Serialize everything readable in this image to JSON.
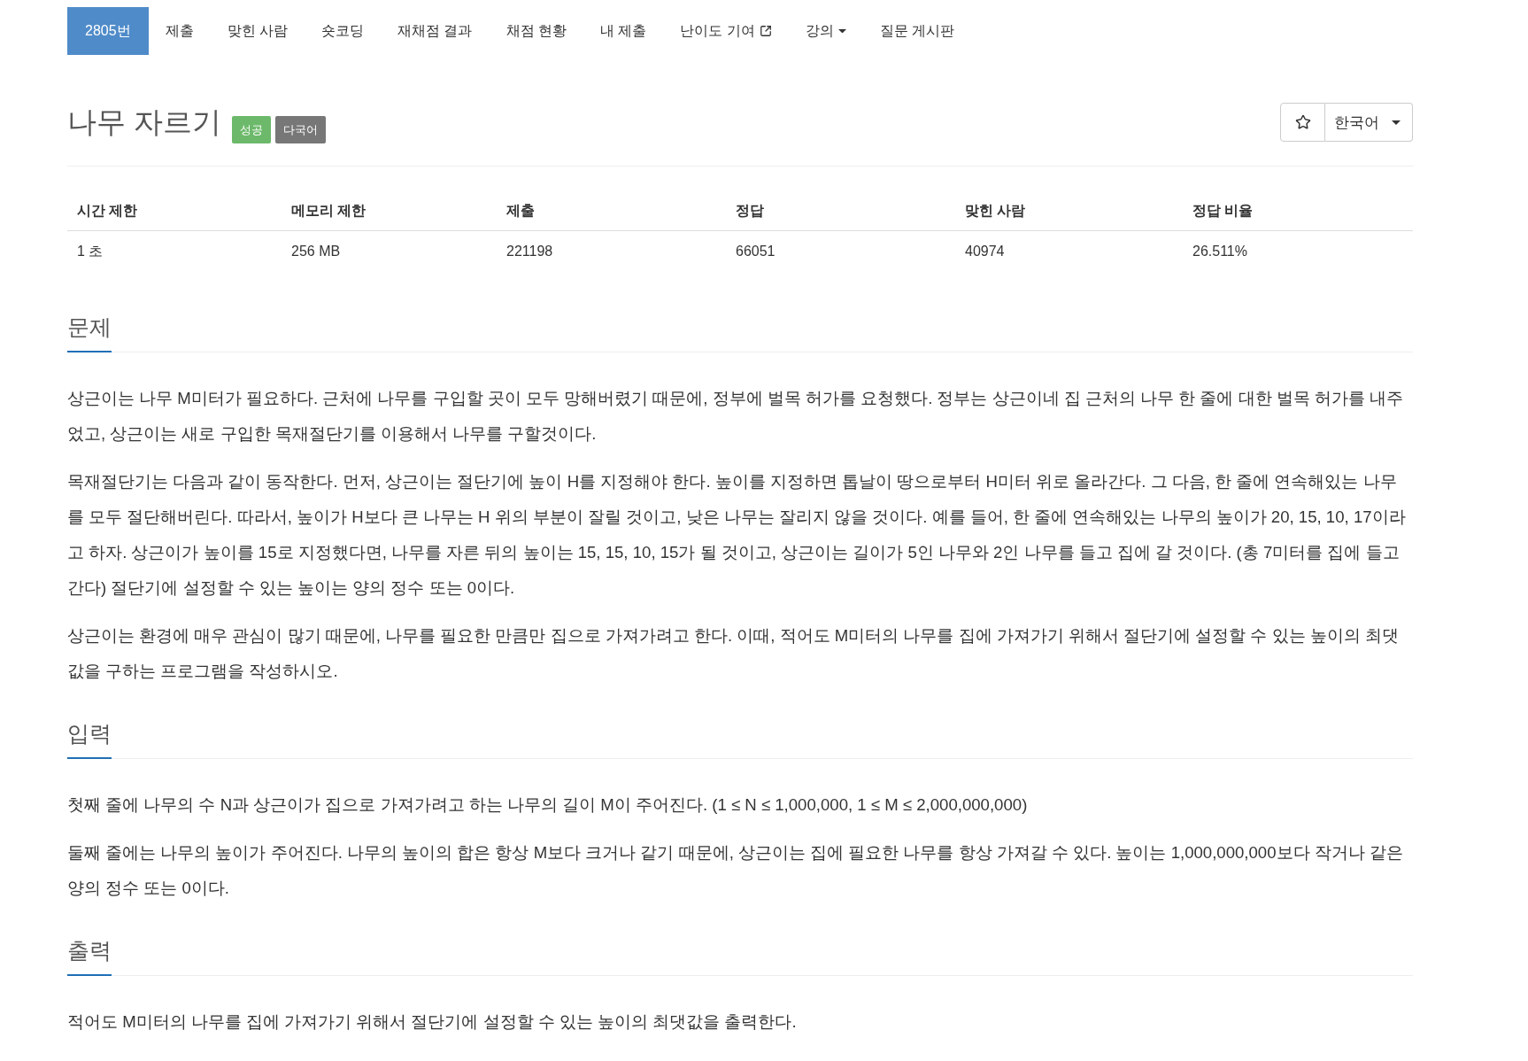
{
  "nav": {
    "items": [
      {
        "label": "2805번",
        "selected": true,
        "kind": "plain"
      },
      {
        "label": "제출",
        "selected": false,
        "kind": "plain"
      },
      {
        "label": "맞힌 사람",
        "selected": false,
        "kind": "plain"
      },
      {
        "label": "숏코딩",
        "selected": false,
        "kind": "plain"
      },
      {
        "label": "재채점 결과",
        "selected": false,
        "kind": "plain"
      },
      {
        "label": "채점 현황",
        "selected": false,
        "kind": "plain"
      },
      {
        "label": "내 제출",
        "selected": false,
        "kind": "plain"
      },
      {
        "label": "난이도 기여",
        "selected": false,
        "kind": "external"
      },
      {
        "label": "강의",
        "selected": false,
        "kind": "dropdown"
      },
      {
        "label": "질문 게시판",
        "selected": false,
        "kind": "plain"
      }
    ]
  },
  "problem": {
    "title": "나무 자르기",
    "badges": [
      {
        "label": "성공",
        "color": "#6db96b"
      },
      {
        "label": "다국어",
        "color": "#777777"
      }
    ]
  },
  "language_select": {
    "value": "한국어"
  },
  "stats": {
    "columns": [
      "시간 제한",
      "메모리 제한",
      "제출",
      "정답",
      "맞힌 사람",
      "정답 비율"
    ],
    "rows": [
      [
        "1 초",
        "256 MB",
        "221198",
        "66051",
        "40974",
        "26.511%"
      ]
    ]
  },
  "sections": [
    {
      "heading": "문제",
      "paragraphs": [
        "상근이는 나무 M미터가 필요하다. 근처에 나무를 구입할 곳이 모두 망해버렸기 때문에, 정부에 벌목 허가를 요청했다. 정부는 상근이네 집 근처의 나무 한 줄에 대한 벌목 허가를 내주었고, 상근이는 새로 구입한 목재절단기를 이용해서 나무를 구할것이다.",
        "목재절단기는 다음과 같이 동작한다. 먼저, 상근이는 절단기에 높이 H를 지정해야 한다. 높이를 지정하면 톱날이 땅으로부터 H미터 위로 올라간다. 그 다음, 한 줄에 연속해있는 나무를 모두 절단해버린다. 따라서, 높이가 H보다 큰 나무는 H 위의 부분이 잘릴 것이고, 낮은 나무는 잘리지 않을 것이다. 예를 들어, 한 줄에 연속해있는 나무의 높이가 20, 15, 10, 17이라고 하자. 상근이가 높이를 15로 지정했다면, 나무를 자른 뒤의 높이는 15, 15, 10, 15가 될 것이고, 상근이는 길이가 5인 나무와 2인 나무를 들고 집에 갈 것이다. (총 7미터를 집에 들고 간다) 절단기에 설정할 수 있는 높이는 양의 정수 또는 0이다.",
        "상근이는 환경에 매우 관심이 많기 때문에, 나무를 필요한 만큼만 집으로 가져가려고 한다. 이때, 적어도 M미터의 나무를 집에 가져가기 위해서 절단기에 설정할 수 있는 높이의 최댓값을 구하는 프로그램을 작성하시오."
      ]
    },
    {
      "heading": "입력",
      "paragraphs": [
        "첫째 줄에 나무의 수 N과 상근이가 집으로 가져가려고 하는 나무의 길이 M이 주어진다. (1 ≤ N ≤ 1,000,000, 1 ≤ M ≤ 2,000,000,000)",
        "둘째 줄에는 나무의 높이가 주어진다. 나무의 높이의 합은 항상 M보다 크거나 같기 때문에, 상근이는 집에 필요한 나무를 항상 가져갈 수 있다. 높이는 1,000,000,000보다 작거나 같은 양의 정수 또는 0이다."
      ]
    },
    {
      "heading": "출력",
      "paragraphs": [
        "적어도 M미터의 나무를 집에 가져가기 위해서 절단기에 설정할 수 있는 높이의 최댓값을 출력한다."
      ]
    }
  ]
}
